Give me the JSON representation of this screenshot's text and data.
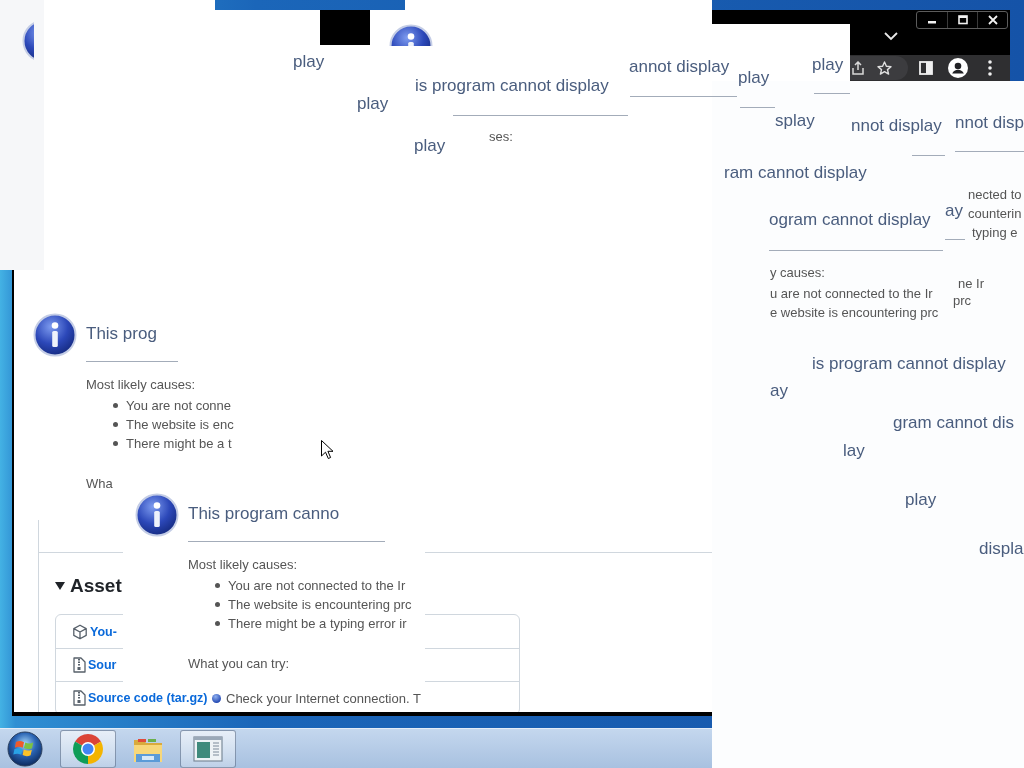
{
  "browser": {
    "page": {
      "assets_section": {
        "title": "Asset",
        "expanded": true,
        "assets": [
          {
            "kind": "package",
            "label": "You-"
          },
          {
            "kind": "archive",
            "label": "Sour"
          },
          {
            "kind": "archive",
            "label": "Source code (tar.gz)"
          }
        ]
      }
    }
  },
  "error_dialogs": [
    {
      "title": "is program cannot display",
      "causes_heading": "ses:"
    },
    {
      "title": "This prog",
      "causes_heading": "Most likely causes:",
      "causes": [
        "You are not conne",
        "The website is enc",
        "There might be a t"
      ],
      "try_heading": "Wha"
    },
    {
      "title": "This program canno",
      "causes_heading": "Most likely causes:",
      "causes": [
        "You are not connected to the Ir",
        "The website is encountering prc",
        "There might be a typing error ir"
      ],
      "try_heading": "What you can try:",
      "try_items": [
        "Check your Internet connection. T"
      ]
    }
  ],
  "text_fragments": [
    {
      "kind": "title",
      "text": "play"
    },
    {
      "kind": "title",
      "text": "play"
    },
    {
      "kind": "title",
      "text": "play"
    },
    {
      "kind": "title",
      "text": "annot display"
    },
    {
      "kind": "title",
      "text": "play"
    },
    {
      "kind": "title",
      "text": "play"
    },
    {
      "kind": "title",
      "text": "splay"
    },
    {
      "kind": "title",
      "text": "nnot display"
    },
    {
      "kind": "title",
      "text": "nnot disp"
    },
    {
      "kind": "title",
      "text": "ram cannot display"
    },
    {
      "kind": "title",
      "text": "ogram cannot display"
    },
    {
      "kind": "title",
      "text": "ay"
    },
    {
      "kind": "body",
      "text": "nected to"
    },
    {
      "kind": "body",
      "text": "counterin"
    },
    {
      "kind": "body",
      "text": "typing e"
    },
    {
      "kind": "body",
      "text": "y causes:"
    },
    {
      "kind": "body",
      "text": "u are not connected to the Ir"
    },
    {
      "kind": "body",
      "text": "e website is encountering prc"
    },
    {
      "kind": "body",
      "text": "ne Ir"
    },
    {
      "kind": "body",
      "text": "prc"
    },
    {
      "kind": "title",
      "text": "is program cannot display"
    },
    {
      "kind": "title",
      "text": "ay"
    },
    {
      "kind": "title",
      "text": "gram cannot dis"
    },
    {
      "kind": "title",
      "text": "lay"
    },
    {
      "kind": "title",
      "text": "play"
    },
    {
      "kind": "title",
      "text": "displa"
    }
  ],
  "taskbar": {
    "apps": [
      {
        "kind": "browser",
        "running": true
      },
      {
        "kind": "folder",
        "running": false
      },
      {
        "kind": "window",
        "running": true
      }
    ]
  }
}
